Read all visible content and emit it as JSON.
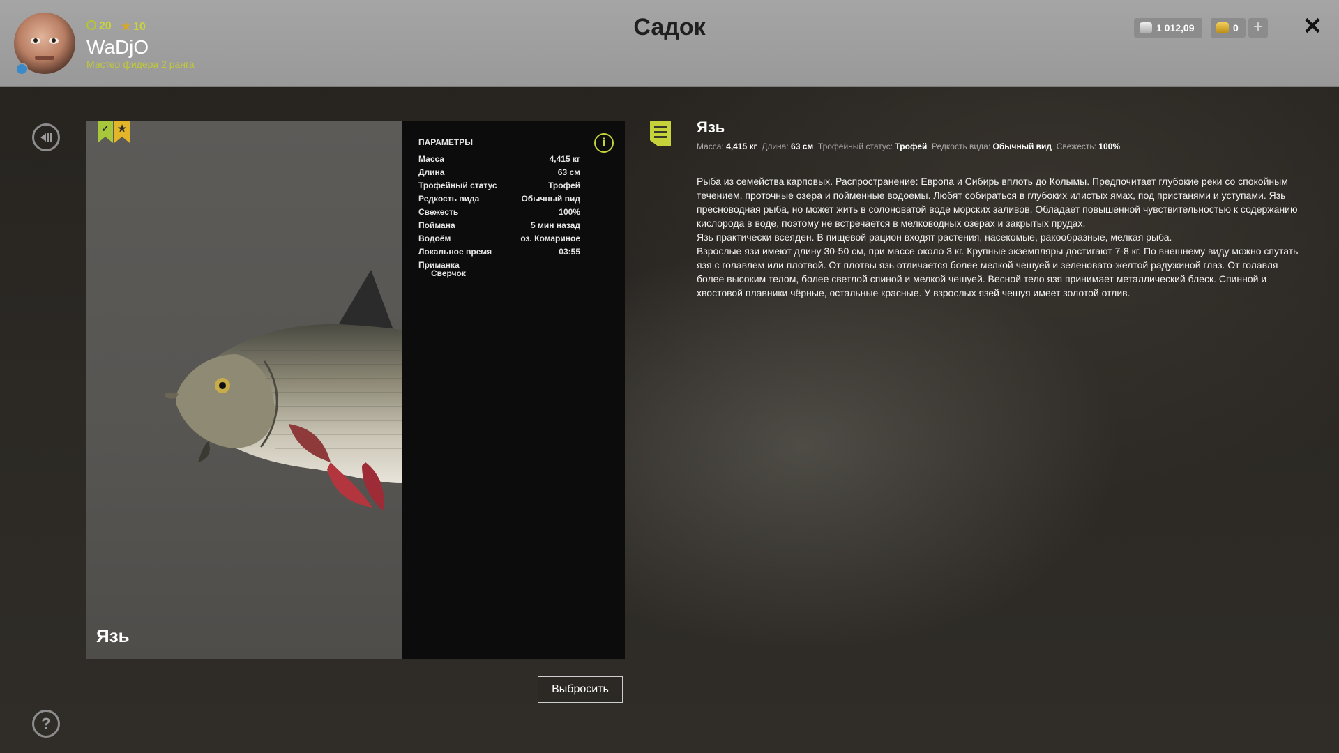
{
  "header": {
    "title": "Садок",
    "stats": {
      "level": "20",
      "stars": "10"
    },
    "username": "WaDjO",
    "rank": "Мастер фидера 2 ранга",
    "silver": "1 012,09",
    "gold": "0",
    "plus_label": "+",
    "close_label": "✕"
  },
  "nav": {
    "back_icon": "back-icon",
    "help_label": "?"
  },
  "fish_card": {
    "name": "Язь",
    "bookmark_check": "✓",
    "bookmark_star": "★",
    "params_title": "ПАРАМЕТРЫ",
    "info_label": "i",
    "params": [
      {
        "label": "Масса",
        "value": "4,415 кг"
      },
      {
        "label": "Длина",
        "value": "63 см"
      },
      {
        "label": "Трофейный статус",
        "value": "Трофей"
      },
      {
        "label": "Редкость вида",
        "value": "Обычный вид"
      },
      {
        "label": "Свежесть",
        "value": "100%"
      },
      {
        "label": "Поймана",
        "value": "5 мин назад"
      },
      {
        "label": "Водоём",
        "value": "оз. Комариное"
      },
      {
        "label": "Локальное время",
        "value": "03:55"
      }
    ],
    "bait_label": "Приманка",
    "bait": "Сверчок",
    "discard_label": "Выбросить"
  },
  "description": {
    "title": "Язь",
    "summary": [
      {
        "label": "Масса:",
        "value": "4,415 кг"
      },
      {
        "label": "Длина:",
        "value": "63 см"
      },
      {
        "label": "Трофейный статус:",
        "value": "Трофей"
      },
      {
        "label": "Редкость вида:",
        "value": "Обычный вид"
      },
      {
        "label": "Свежесть:",
        "value": "100%"
      }
    ],
    "paragraphs": [
      "Рыба из семейства карповых. Распространение: Европа и Сибирь вплоть до Колымы. Предпочитает глубокие реки со спокойным течением, проточные озера и пойменные водоемы. Любят собираться в глубоких илистых ямах, под пристанями и уступами. Язь пресноводная рыба, но может жить в солоноватой воде морских заливов. Обладает повышенной чувствительностью к содержанию кислорода в воде, поэтому не встречается в мелководных озерах и закрытых прудах.",
      "Язь практически всеяден. В пищевой рацион входят растения, насекомые, ракообразные, мелкая рыба.",
      "Взрослые язи имеют длину 30-50 см, при массе около 3 кг. Крупные экземпляры достигают 7-8 кг. По внешнему виду можно спутать язя с голавлем или плотвой. От плотвы язь отличается более мелкой чешуей и зеленовато-желтой радужиной глаз. От голавля более высоким телом, более светлой спиной и мелкой чешуей. Весной тело язя принимает металлический блеск. Спинной и хвостовой плавники чёрные, остальные красные. У взрослых язей чешуя имеет золотой отлив."
    ]
  }
}
